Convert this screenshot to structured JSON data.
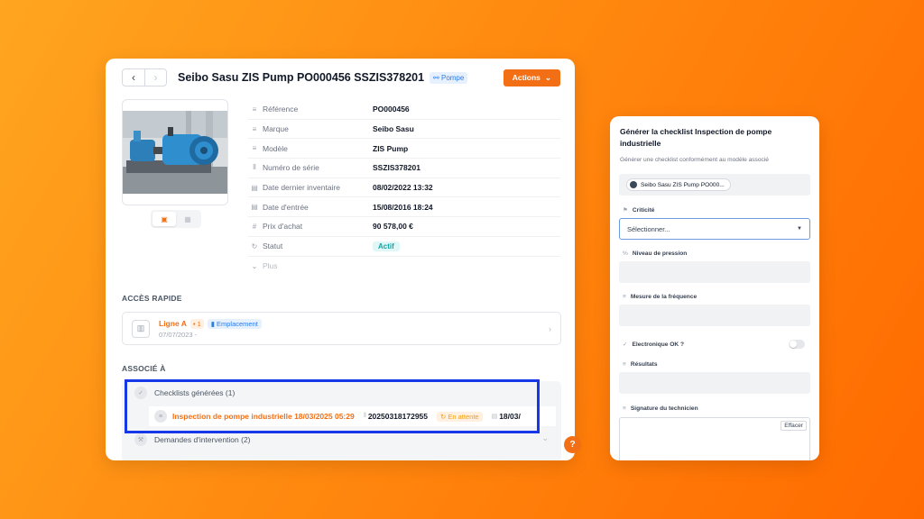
{
  "header": {
    "title": "Seibo Sasu ZIS Pump PO000456 SSZIS378201",
    "category_tag": "Pompe",
    "actions_label": "Actions"
  },
  "properties": [
    {
      "label": "Référence",
      "value": "PO000456",
      "icon": "lines-icon"
    },
    {
      "label": "Marque",
      "value": "Seibo Sasu",
      "icon": "lines-icon"
    },
    {
      "label": "Modèle",
      "value": " ZIS Pump",
      "icon": "lines-icon"
    },
    {
      "label": "Numéro de série",
      "value": "SSZIS378201",
      "icon": "barcode-icon"
    },
    {
      "label": "Date dernier inventaire",
      "value": "08/02/2022 13:32",
      "icon": "calendar-icon"
    },
    {
      "label": "Date d'entrée",
      "value": "15/08/2016 18:24",
      "icon": "calendar-icon"
    },
    {
      "label": "Prix d'achat",
      "value": "90 578,00 €",
      "icon": "hash-icon"
    },
    {
      "label": "Statut",
      "value": "Actif",
      "icon": "refresh-icon"
    },
    {
      "label": "Plus",
      "value": "",
      "icon": "chevron-down-icon"
    }
  ],
  "quick_access": {
    "section_label": "ACCÈS RAPIDE",
    "name": "Ligne A",
    "count": "1",
    "location_tag": "Emplacement",
    "date": "07/07/2023 -"
  },
  "associated": {
    "section_label": "ASSOCIÉ À",
    "checklists_label": "Checklists générées (1)",
    "checklist_item": {
      "title": "Inspection de pompe industrielle 18/03/2025 05:29",
      "code": "20250318172955",
      "status": "En attente",
      "date": "18/03/"
    },
    "interventions_label": "Demandes d'intervention (2)",
    "help_label": "?"
  },
  "form": {
    "title": "Générer la checklist Inspection de pompe industrielle",
    "subtitle": "Générer une checklist conformément au modèle associé",
    "asset_chip": "Seibo Sasu ZIS Pump PO000...",
    "fields": {
      "criticite": "Criticité",
      "criticite_placeholder": "Sélectionner...",
      "pression": "Niveau de pression",
      "frequence": "Mesure de la fréquence",
      "electronique": "Electronique OK ?",
      "resultats": "Résultats",
      "signature": "Signature du technicien",
      "clear_label": "Effacer"
    }
  },
  "colors": {
    "accent": "#f36f15",
    "highlight_border": "#1738e8",
    "badge_teal": "#14a3a3",
    "tag_blue": "#2d7be5"
  }
}
